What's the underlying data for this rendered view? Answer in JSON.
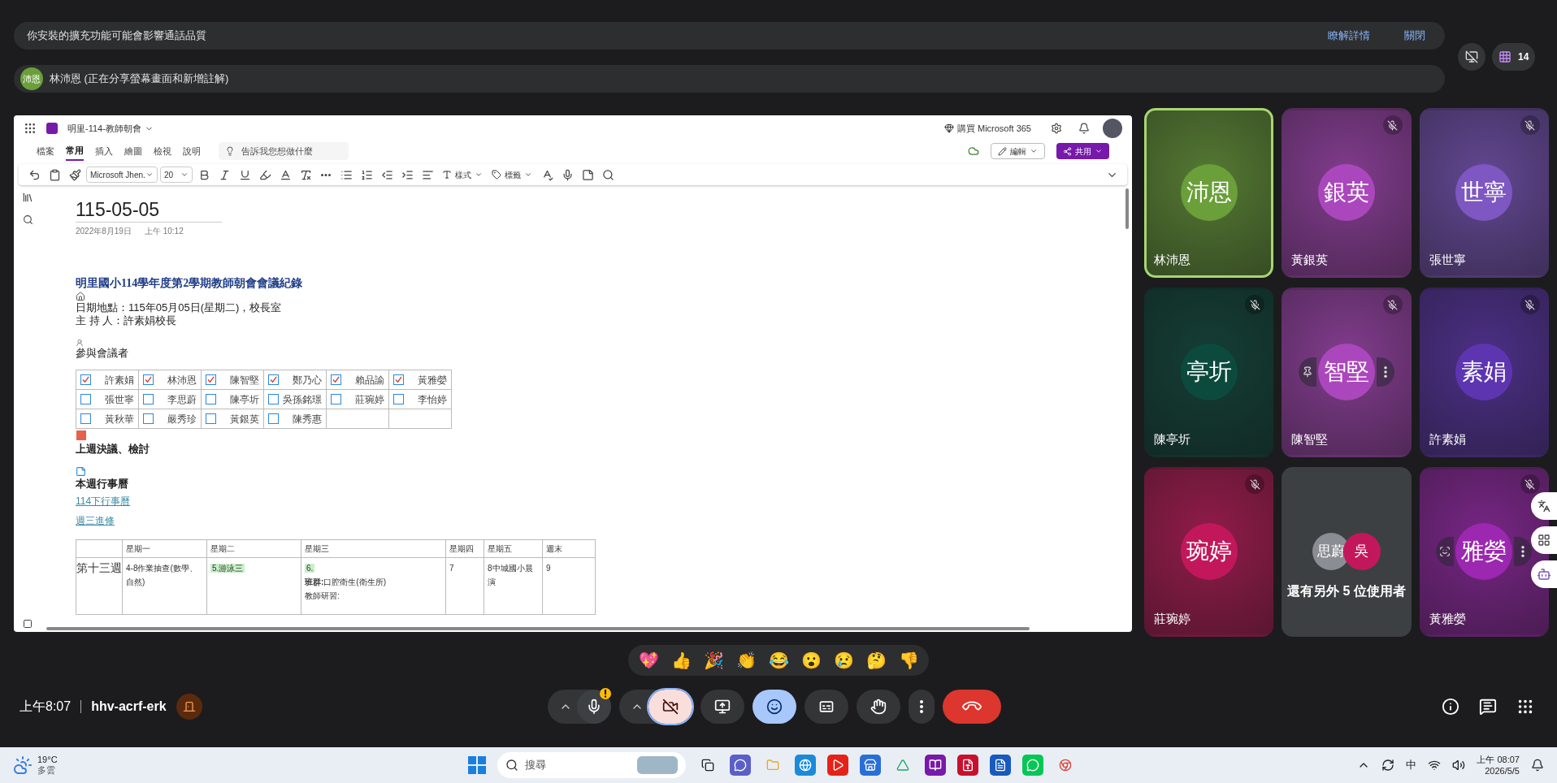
{
  "banners": [
    {
      "text": "你安裝的擴充功能可能會影響通話品質",
      "actions": [
        "瞭解詳情",
        "關閉"
      ]
    }
  ],
  "presenter": {
    "initials": "沛恩",
    "color": "#6a9f3a",
    "text": "林沛恩 (正在分享螢幕畫面和新增註解)"
  },
  "participant_count": "14",
  "document": {
    "notebook": "明里-114-教師朝會",
    "buy": "購買 Microsoft 365",
    "tabs": [
      {
        "label": "檔案",
        "selected": false
      },
      {
        "label": "常用",
        "selected": true
      },
      {
        "label": "插入",
        "selected": false
      },
      {
        "label": "繪圖",
        "selected": false
      },
      {
        "label": "檢視",
        "selected": false
      },
      {
        "label": "說明",
        "selected": false
      }
    ],
    "search": {
      "placeholder": "告訴我您想做什麼"
    },
    "edit_button": "編輯",
    "share_button": "共用",
    "font": "Microsoft Jhen.",
    "font_size": "20",
    "styles_button": "樣式",
    "tags_button": "標籤",
    "page": {
      "title": "115-05-05",
      "date": "2022年8月19日",
      "time": "上午 10:12",
      "heading": "明里國小114學年度第2學期教師朝會會議紀錄",
      "lines": [
        "日期地點：115年05月05日(星期二)，校長室",
        "主 持 人：許素娟校長"
      ],
      "attendees_label": "參與會議者",
      "attendees": [
        [
          {
            "name": "許素娟",
            "checked": true
          },
          {
            "name": "林沛恩",
            "checked": true
          },
          {
            "name": "陳智堅",
            "checked": true
          },
          {
            "name": "鄭乃心",
            "checked": true
          },
          {
            "name": "賴品諭",
            "checked": true
          },
          {
            "name": "黃雅嫈",
            "checked": true
          }
        ],
        [
          {
            "name": "張世寧",
            "checked": false
          },
          {
            "name": "李思蔚",
            "checked": false
          },
          {
            "name": "陳亭圻",
            "checked": false
          },
          {
            "name": "吳孫銘璟",
            "checked": false
          },
          {
            "name": "莊琬婷",
            "checked": false
          },
          {
            "name": "李怡婷",
            "checked": false
          }
        ],
        [
          {
            "name": "黃秋華",
            "checked": false
          },
          {
            "name": "嚴秀珍",
            "checked": false
          },
          {
            "name": "黃銀英",
            "checked": false
          },
          {
            "name": "陳秀惠",
            "checked": false
          }
        ]
      ],
      "section_1": "上週決議、檢討",
      "section_2": "本週行事曆",
      "links": [
        "114下行事曆",
        "週三進修"
      ],
      "calendar": {
        "columns": [
          "星期一",
          "星期二",
          "星期三",
          "星期四",
          "星期五",
          "週末"
        ],
        "rows": [
          {
            "label": "第十三週",
            "cells": [
              [
                {
                  "text": "4-8作業抽查(數學、自然)",
                  "highlight": false
                }
              ],
              [
                {
                  "text": "5.游泳三",
                  "highlight": true
                }
              ],
              [
                {
                  "text": "6.",
                  "highlight": true
                },
                {
                  "text": "**班群:**口腔衛生(衛生所)",
                  "highlight": false
                },
                {
                  "text": "教師研習:",
                  "highlight": false
                }
              ],
              [
                {
                  "text": "7",
                  "highlight": false
                }
              ],
              [
                {
                  "text": "8中城國小晨演",
                  "highlight": false
                }
              ],
              [
                {
                  "text": "9",
                  "highlight": false
                }
              ]
            ]
          }
        ]
      }
    }
  },
  "tiles": [
    {
      "kind": "person",
      "name": "林沛恩",
      "initials": "沛恩",
      "color": "#6a9f3a",
      "muted": false,
      "speaking": true
    },
    {
      "kind": "person",
      "name": "黃銀英",
      "initials": "銀英",
      "color": "#ab47bc",
      "muted": true,
      "speaking": false
    },
    {
      "kind": "person",
      "name": "張世寧",
      "initials": "世寧",
      "color": "#7e57c2",
      "muted": true,
      "speaking": false
    },
    {
      "kind": "person",
      "name": "陳亭圻",
      "initials": "亭圻",
      "color": "#0d4a3e",
      "muted": true,
      "speaking": false
    },
    {
      "kind": "person",
      "name": "陳智堅",
      "initials": "智堅",
      "color": "#ab47bc",
      "muted": true,
      "speaking": false,
      "hover_menu": {
        "kind": "pin"
      }
    },
    {
      "kind": "person",
      "name": "許素娟",
      "initials": "素娟",
      "color": "#5e35b1",
      "muted": true,
      "speaking": false
    },
    {
      "kind": "person",
      "name": "莊琬婷",
      "initials": "琬婷",
      "color": "#c2185b",
      "muted": true,
      "speaking": false
    },
    {
      "kind": "others",
      "label": "還有另外 5 位使用者",
      "avatars": [
        {
          "initials": "思蔚",
          "color": "#8a8d93"
        },
        {
          "initials": "吳",
          "color": "#c2185b"
        }
      ]
    },
    {
      "kind": "person",
      "name": "黃雅嫈",
      "initials": "雅嫈",
      "color": "#9c27b0",
      "muted": true,
      "speaking": false,
      "hover_menu": {
        "kind": "reframe"
      }
    }
  ],
  "reactions": [
    "💖",
    "👍",
    "🎉",
    "👏",
    "😂",
    "😮",
    "😢",
    "🤔",
    "👎"
  ],
  "meeting": {
    "time": "上午8:07",
    "code": "hhv-acrf-erk"
  },
  "controls": [
    {
      "kind": "mic",
      "on": true,
      "warning": true
    },
    {
      "kind": "camera",
      "on": false
    },
    {
      "kind": "present"
    },
    {
      "kind": "reactions",
      "selected": true
    },
    {
      "kind": "captions",
      "selected": false
    },
    {
      "kind": "hand",
      "selected": false
    },
    {
      "kind": "more"
    },
    {
      "kind": "leave"
    }
  ],
  "taskbar": {
    "temperature": "19°C",
    "weather": "多雲",
    "search_placeholder": "搜尋",
    "ime": "中",
    "time": "上午 08:07",
    "date": "2026/5/5"
  }
}
